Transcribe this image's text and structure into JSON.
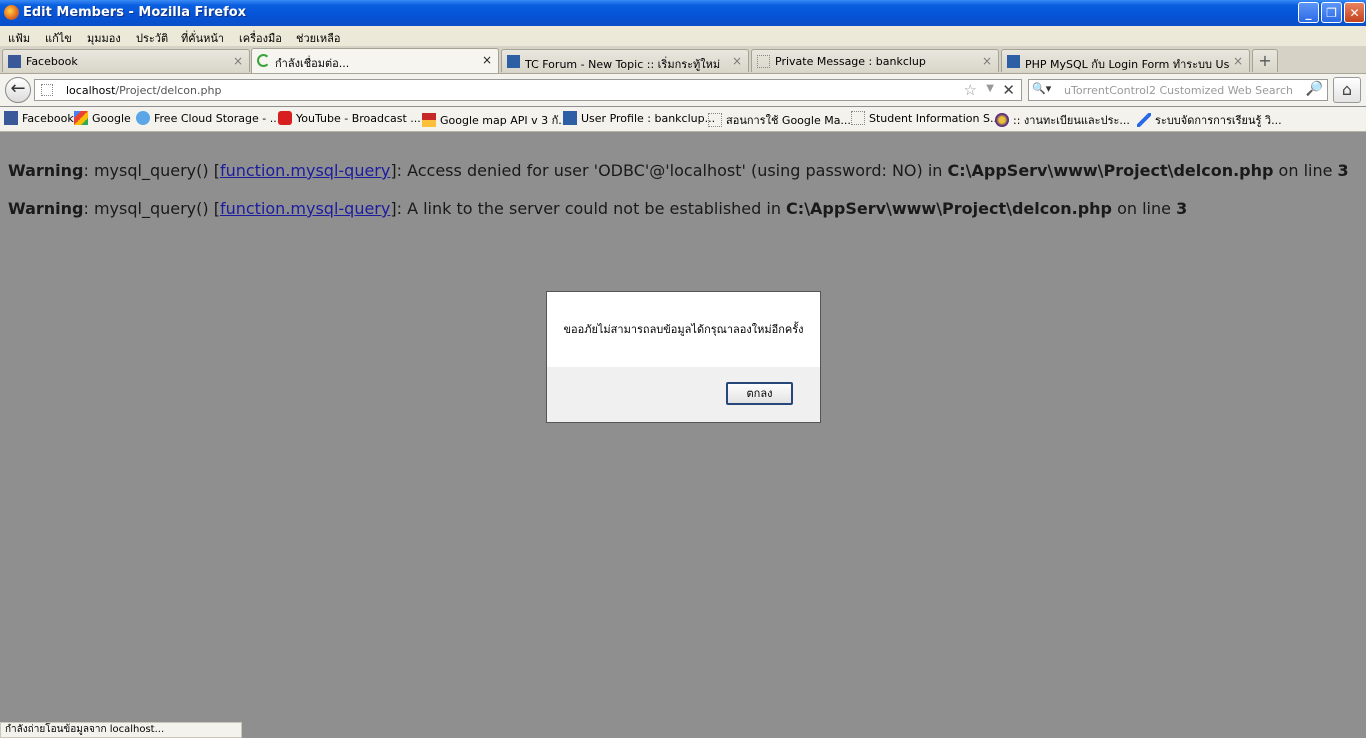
{
  "window": {
    "title": "Edit Members - Mozilla Firefox",
    "minimize": "_",
    "maximize": "❐",
    "close": "✕"
  },
  "menu": [
    "แฟ้ม",
    "แก้ไข",
    "มุมมอง",
    "ประวัติ",
    "ที่คั่นหน้า",
    "เครื่องมือ",
    "ช่วยเหลือ"
  ],
  "tabs": [
    {
      "label": "Facebook",
      "icon": "facebook-icon",
      "active": false
    },
    {
      "label": "กำลังเชื่อมต่อ...",
      "icon": "loading-spinner-icon",
      "active": true
    },
    {
      "label": "TC Forum - New Topic :: เริ่มกระทู้ใหม่",
      "icon": "forum-icon",
      "active": false
    },
    {
      "label": "Private Message : bankclup",
      "icon": "blank-page-icon",
      "active": false
    },
    {
      "label": "PHP MySQL กับ Login Form ทำระบบ User ...",
      "icon": "forum-icon",
      "active": false
    }
  ],
  "tab_close": "×",
  "new_tab": "+",
  "nav": {
    "back": "←",
    "url_host": "localhost",
    "url_path": "/Project/delcon.php",
    "star": "☆",
    "dropdown": "▼",
    "stop": "✕",
    "search_engine": "🔍▾",
    "search_placeholder": "uTorrentControl2 Customized Web Search",
    "search_go": "🔎",
    "home": "⌂"
  },
  "bookmarks": [
    {
      "label": "Facebook",
      "icon": "facebook-icon"
    },
    {
      "label": "Google",
      "icon": "google-icon"
    },
    {
      "label": "Free Cloud Storage - ...",
      "icon": "cloud-icon"
    },
    {
      "label": "YouTube - Broadcast ...",
      "icon": "youtube-icon"
    },
    {
      "label": "Google map API v 3 กั...",
      "icon": "map-icon"
    },
    {
      "label": "User Profile : bankclup...",
      "icon": "forum-icon"
    },
    {
      "label": "สอนการใช้ Google Ma...",
      "icon": "blank-page-icon"
    },
    {
      "label": "Student Information S...",
      "icon": "blank-page-icon"
    },
    {
      "label": ":: งานทะเบียนและประ...",
      "icon": "university-icon"
    },
    {
      "label": "ระบบจัดการการเรียนรู้ วิ...",
      "icon": "feather-icon"
    }
  ],
  "warnings": [
    {
      "label": "Warning",
      "text1": ": mysql_query() [",
      "link": "function.mysql-query",
      "text2": "]: Access denied for user 'ODBC'@'localhost' (using password: NO) in ",
      "path": "C:\\AppServ\\www\\Project\\delcon.php",
      "text3": " on line ",
      "line": "3"
    },
    {
      "label": "Warning",
      "text1": ": mysql_query() [",
      "link": "function.mysql-query",
      "text2": "]: A link to the server could not be established in ",
      "path": "C:\\AppServ\\www\\Project\\delcon.php",
      "text3": " on line ",
      "line": "3"
    }
  ],
  "dialog": {
    "message": "ขออภัยไม่สามารถลบข้อมูลได้กรุณาลองใหม่อีกครั้ง",
    "ok_label": "ตกลง"
  },
  "status": "กำลังถ่ายโอนข้อมูลจาก localhost..."
}
